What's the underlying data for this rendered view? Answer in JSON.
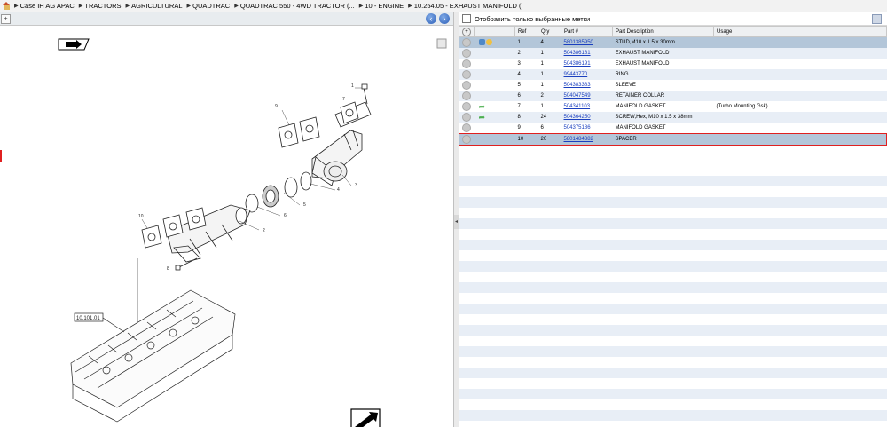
{
  "breadcrumb": [
    "Case IH AG APAC",
    "TRACTORS",
    "AGRICULTURAL",
    "QUADTRAC",
    "QUADTRAC 550 - 4WD TRACTOR (...",
    "10 - ENGINE",
    "10.254.05 - EXHAUST MANIFOLD ("
  ],
  "diagram": {
    "section_label": "10.101.01",
    "callouts": [
      "1",
      "2",
      "3",
      "4",
      "5",
      "6",
      "7",
      "8",
      "9",
      "10"
    ]
  },
  "filter": {
    "label": "Отобразить только выбранные метки"
  },
  "table": {
    "headers": {
      "ref": "Ref",
      "qty": "Qty",
      "part": "Part #",
      "desc": "Part Description",
      "usage": "Usage"
    },
    "rows": [
      {
        "ref": "1",
        "qty": "4",
        "part": "5801385950",
        "desc": "STUD,M10 x 1.5 x 30mm",
        "usage": ""
      },
      {
        "ref": "2",
        "qty": "1",
        "part": "504386181",
        "desc": "EXHAUST MANIFOLD",
        "usage": ""
      },
      {
        "ref": "3",
        "qty": "1",
        "part": "504386191",
        "desc": "EXHAUST MANIFOLD",
        "usage": ""
      },
      {
        "ref": "4",
        "qty": "1",
        "part": "99443770",
        "desc": "RING",
        "usage": ""
      },
      {
        "ref": "5",
        "qty": "1",
        "part": "504383383",
        "desc": "SLEEVE",
        "usage": ""
      },
      {
        "ref": "6",
        "qty": "2",
        "part": "504047549",
        "desc": "RETAINER COLLAR",
        "usage": ""
      },
      {
        "ref": "7",
        "qty": "1",
        "part": "504341103",
        "desc": "MANIFOLD GASKET",
        "usage": "(Turbo Mounting Gsk)"
      },
      {
        "ref": "8",
        "qty": "24",
        "part": "504364250",
        "desc": "SCREW,Hex, M10 x 1.5 x 38mm",
        "usage": ""
      },
      {
        "ref": "9",
        "qty": "6",
        "part": "504375186",
        "desc": "MANIFOLD GASKET",
        "usage": ""
      },
      {
        "ref": "10",
        "qty": "20",
        "part": "5801484382",
        "desc": "SPACER",
        "usage": ""
      }
    ]
  },
  "colors": {
    "selected_row": "#b3c6d9",
    "alt_row": "#e8eef6",
    "highlight_border": "#e02020",
    "link": "#1a3fbf"
  }
}
